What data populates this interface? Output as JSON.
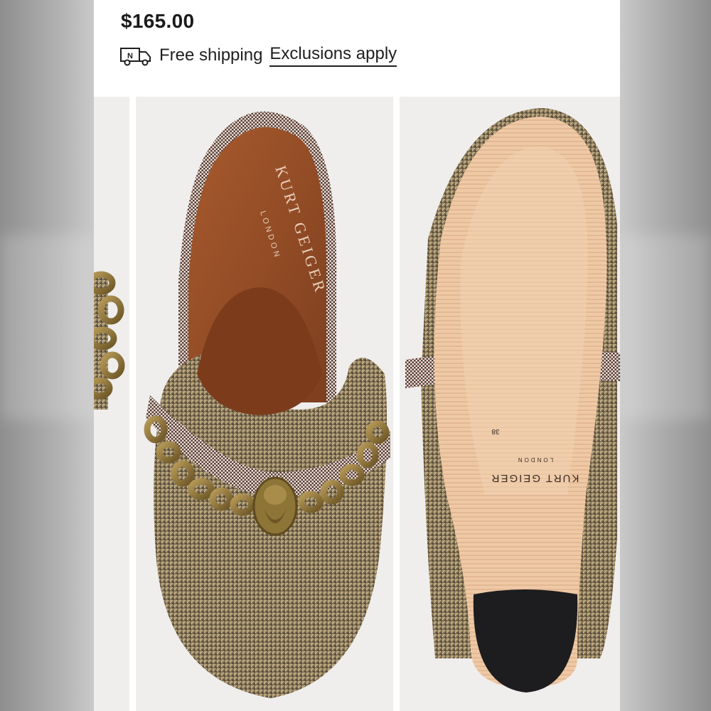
{
  "product": {
    "price": "$165.00",
    "shipping_label": "Free shipping",
    "exclusions_link": "Exclusions apply"
  },
  "icons": {
    "shipping": "delivery-truck-icon"
  },
  "gallery": {
    "images": [
      {
        "alt": "Chain detail (partial)"
      },
      {
        "alt": "Top view of mule"
      },
      {
        "alt": "Sole view of mule"
      }
    ],
    "insole_brand": "KURT GEIGER",
    "insole_sub": "LONDON",
    "sole_brand": "KURT GEIGER",
    "sole_sub": "LONDON",
    "sole_size": "38"
  },
  "colors": {
    "insole": "#9a4f27",
    "outsole": "#efc9a6",
    "fabric": "#8b7b5c",
    "chain": "#8d7437",
    "heel_cap": "#1d1d1f"
  }
}
